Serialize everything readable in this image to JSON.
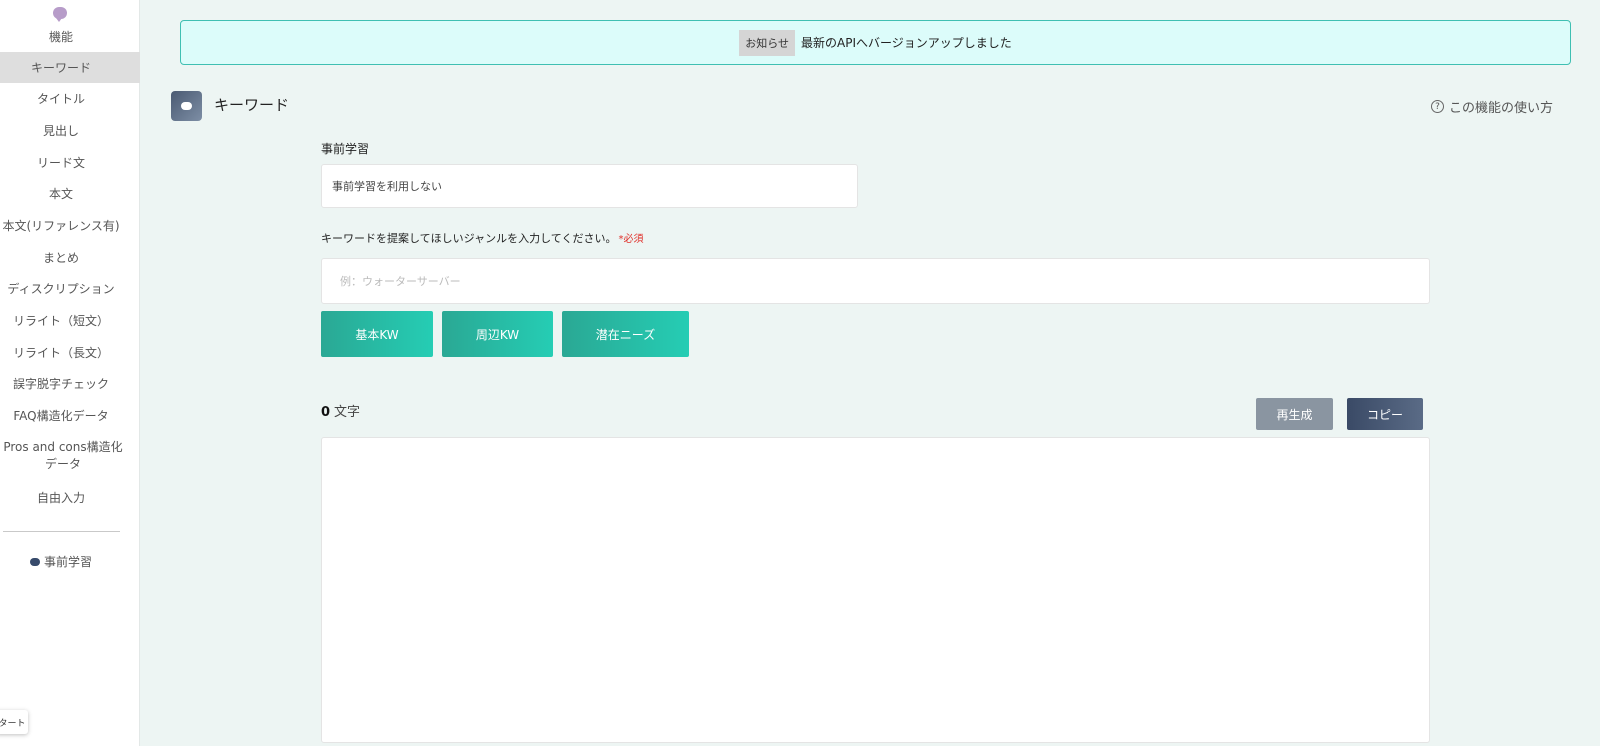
{
  "sidebar": {
    "top_label": "機能",
    "items": [
      {
        "label": "キーワード",
        "active": true
      },
      {
        "label": "タイトル"
      },
      {
        "label": "見出し"
      },
      {
        "label": "リード文"
      },
      {
        "label": "本文"
      },
      {
        "label": "本文(リファレンス有)"
      },
      {
        "label": "まとめ"
      },
      {
        "label": "ディスクリプション"
      },
      {
        "label": "リライト（短文）"
      },
      {
        "label": "リライト（長文）"
      },
      {
        "label": "誤字脱字チェック"
      },
      {
        "label": "FAQ構造化データ"
      },
      {
        "label": "Pros and cons構造化データ"
      },
      {
        "label": "自由入力"
      }
    ],
    "learning_label": "事前学習",
    "start_chip": "タート"
  },
  "notice": {
    "badge": "お知らせ",
    "text": "最新のAPIへバージョンアップしました"
  },
  "page": {
    "title": "キーワード",
    "help_link": "この機能の使い方"
  },
  "form": {
    "pretrain_label": "事前学習",
    "pretrain_value": "事前学習を利用しない",
    "genre_label": "キーワードを提案してほしいジャンルを入力してください。",
    "required_mark": "*必須",
    "genre_placeholder": "例：ウォーターサーバー",
    "genre_value": "",
    "buttons": {
      "basic": "基本KW",
      "related": "周辺KW",
      "needs": "潜在ニーズ"
    }
  },
  "output": {
    "count": "0",
    "count_unit": "文字",
    "regenerate": "再生成",
    "copy": "コピー",
    "content": ""
  },
  "colors": {
    "accent": "#25cdb4",
    "notice_bg": "#dcfcfa",
    "required": "#e0302a",
    "dark_button": "#3a4a66"
  }
}
